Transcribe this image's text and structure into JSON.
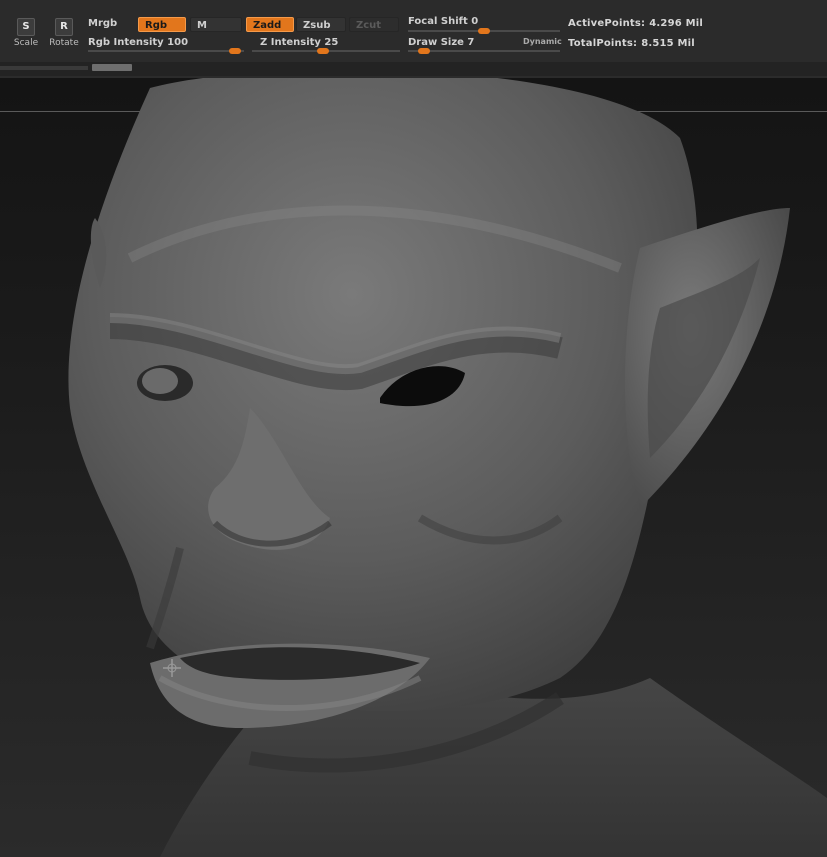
{
  "tools": {
    "scale": {
      "key": "S",
      "label": "Scale"
    },
    "rotate": {
      "key": "R",
      "label": "Rotate"
    }
  },
  "color_mode": {
    "mrgb": "Mrgb",
    "rgb": "Rgb",
    "m": "M"
  },
  "z_mode": {
    "zadd": "Zadd",
    "zsub": "Zsub",
    "zcut": "Zcut"
  },
  "rgb_intensity": {
    "label": "Rgb  Intensity 100",
    "value": 100
  },
  "z_intensity": {
    "label": "Z  Intensity 25",
    "value": 25
  },
  "focal_shift": {
    "label": "Focal  Shift 0",
    "value": 0
  },
  "draw_size": {
    "label": "Draw  Size 7",
    "value": 7,
    "dynamic": "Dynamic"
  },
  "stats": {
    "active_label": "ActivePoints:",
    "active_value": "4.296  Mil",
    "total_label": "TotalPoints:",
    "total_value": "8.515  Mil"
  },
  "colors": {
    "accent": "#e2761c",
    "toolbar_bg": "#2b2b2b",
    "viewport_bg": "#1c1c1c"
  },
  "viewport": {
    "content": "gray sculpted goblin head model"
  }
}
